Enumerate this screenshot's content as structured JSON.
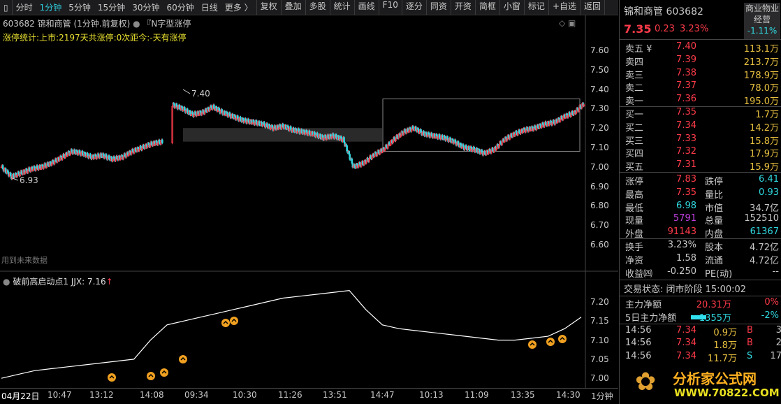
{
  "toolbar": {
    "items": [
      "分时",
      "1分钟",
      "5分钟",
      "15分钟",
      "30分钟",
      "60分钟",
      "日线",
      "更多 〉"
    ],
    "active": "1分钟",
    "tools": [
      "复权",
      "叠加",
      "多股",
      "统计",
      "画线",
      "F10",
      "逐分",
      "同资",
      "开资",
      "简框",
      "小窗",
      "标记",
      "+自选",
      "返回"
    ]
  },
  "chart": {
    "title": "603682 锦和商管 (1分钟.前复权)",
    "formula": "『N字型涨停",
    "stat": "涨停统计:上市:2197天共涨停:0次距今:-天有涨停",
    "future": "用到未来数据",
    "high_label": "7.40",
    "low_label": "6.93",
    "y_ticks": [
      "7.60",
      "7.50",
      "7.40",
      "7.30",
      "7.20",
      "7.10",
      "7.00",
      "6.90",
      "6.80",
      "6.70",
      "6.60"
    ],
    "closes": [
      7.0,
      6.95,
      6.97,
      6.99,
      7.0,
      7.02,
      7.05,
      7.08,
      7.07,
      7.05,
      7.06,
      7.04,
      7.05,
      7.08,
      7.1,
      7.12,
      7.13,
      7.32,
      7.3,
      7.27,
      7.28,
      7.31,
      7.28,
      7.26,
      7.24,
      7.23,
      7.22,
      7.2,
      7.21,
      7.19,
      7.18,
      7.17,
      7.15,
      7.16,
      7.14,
      7.0,
      7.02,
      7.06,
      7.09,
      7.14,
      7.18,
      7.2,
      7.17,
      7.16,
      7.15,
      7.13,
      7.1,
      7.09,
      7.07,
      7.09,
      7.14,
      7.17,
      7.19,
      7.2,
      7.22,
      7.23,
      7.26,
      7.28,
      7.33
    ],
    "up_color": "#ff3b4a",
    "down_color": "#30d8e0"
  },
  "indicator": {
    "name": "破前高启动点1",
    "jjx_label": "JJX: 7.16",
    "y_ticks": [
      "7.20",
      "7.15",
      "7.10",
      "7.05",
      "7.00"
    ],
    "line": [
      7.0,
      7.01,
      7.02,
      7.025,
      7.03,
      7.035,
      7.04,
      7.045,
      7.05,
      7.1,
      7.14,
      7.15,
      7.16,
      7.17,
      7.18,
      7.19,
      7.2,
      7.21,
      7.215,
      7.22,
      7.225,
      7.23,
      7.18,
      7.14,
      7.13,
      7.125,
      7.12,
      7.115,
      7.11,
      7.105,
      7.1,
      7.1,
      7.105,
      7.11,
      7.13,
      7.16
    ]
  },
  "x_labels": [
    "04月22日",
    "10:47",
    "13:12",
    "14:08",
    "09:34",
    "10:30",
    "11:26",
    "13:51",
    "14:47",
    "10:13",
    "11:09",
    "13:35",
    "14:30",
    "1分钟"
  ],
  "quote": {
    "name_code": "锦和商管 603682",
    "sector": "商业物业",
    "sector2": "经营",
    "sector_chg": "-1.11%",
    "price": "7.35",
    "change": "0.23",
    "pct": "3.23%",
    "asks": [
      [
        "卖五 ¥",
        "7.40",
        "113.1万"
      ],
      [
        "卖四",
        "7.39",
        "213.7万"
      ],
      [
        "卖三",
        "7.38",
        "178.9万"
      ],
      [
        "卖二",
        "7.37",
        "78.0万"
      ],
      [
        "卖一",
        "7.36",
        "195.0万"
      ]
    ],
    "bids": [
      [
        "买一",
        "7.35",
        "1.7万"
      ],
      [
        "买二",
        "7.34",
        "14.2万"
      ],
      [
        "买三",
        "7.33",
        "15.8万"
      ],
      [
        "买四",
        "7.32",
        "17.9万"
      ],
      [
        "买五",
        "7.31",
        "15.9万"
      ]
    ],
    "stats": [
      [
        "涨停",
        "7.83",
        "跌停",
        "6.41"
      ],
      [
        "最高",
        "7.35",
        "量比",
        "0.93"
      ],
      [
        "最低",
        "6.98",
        "市值",
        "34.7亿"
      ],
      [
        "现量",
        "5791",
        "总量",
        "152510"
      ],
      [
        "外盘",
        "91143",
        "内盘",
        "61367"
      ],
      [
        "换手",
        "3.23%",
        "股本",
        "4.72亿"
      ],
      [
        "净资",
        "1.58",
        "流通",
        "4.72亿"
      ],
      [
        "收益㈣",
        "-0.250",
        "PE(动)",
        "--"
      ]
    ],
    "status": "交易状态: 闭市阶段 15:00:02",
    "flow": [
      [
        "主力净额",
        "20.31万",
        "0%"
      ],
      [
        "5日主力净额",
        "-1355万",
        "-2%"
      ]
    ],
    "ticks": [
      [
        "14:56",
        "7.34",
        "0.9万",
        "B",
        "3"
      ],
      [
        "14:56",
        "7.34",
        "1.8万",
        "B",
        "2"
      ],
      [
        "14:56",
        "7.34",
        "11.7万",
        "S",
        "17"
      ]
    ]
  },
  "watermark": {
    "cn": "分析家公式网",
    "url": "WWW.70822.COM"
  }
}
